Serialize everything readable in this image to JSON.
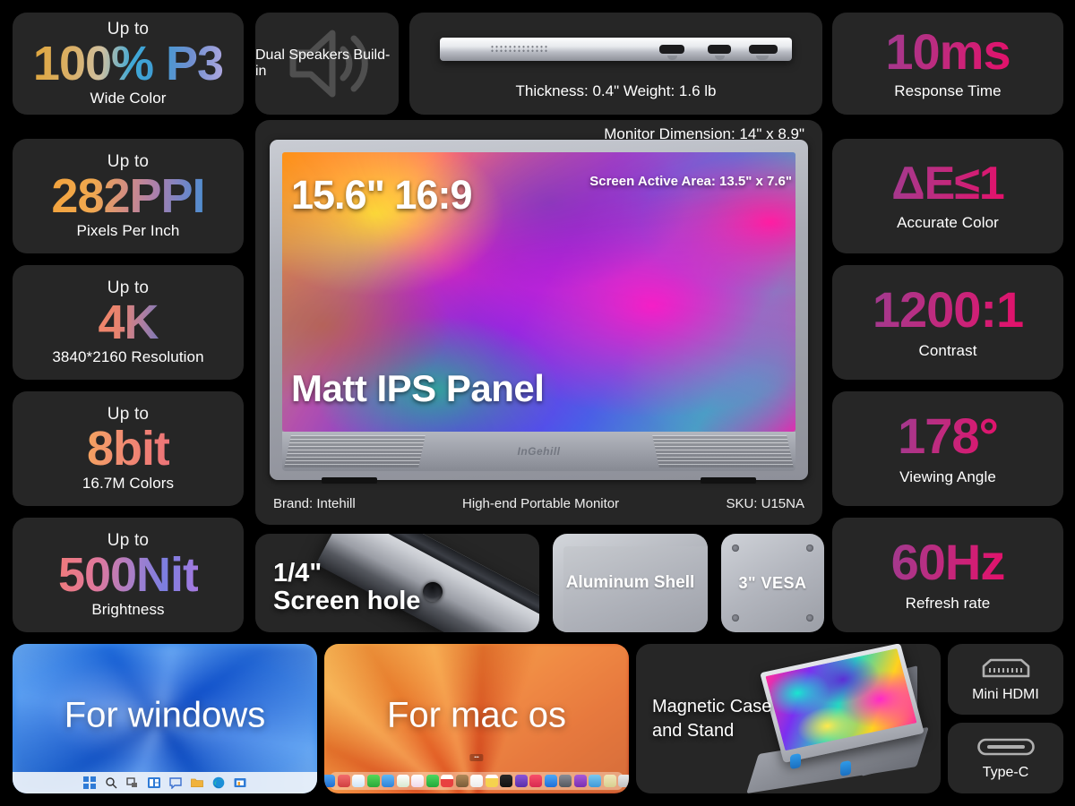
{
  "meta": {
    "background": "#000000",
    "card_bg": "#262626"
  },
  "left_specs": [
    {
      "eyebrow": "Up to",
      "value": "100% P3",
      "caption": "Wide Color",
      "grad": "g-p3"
    },
    {
      "eyebrow": "Up to",
      "value": "282PPI",
      "caption": "Pixels Per Inch",
      "grad": "g-ppi"
    },
    {
      "eyebrow": "Up to",
      "value": "4K",
      "caption": "3840*2160 Resolution",
      "grad": "g-4k"
    },
    {
      "eyebrow": "Up to",
      "value": "8bit",
      "caption": "16.7M Colors",
      "grad": "g-8bit"
    },
    {
      "eyebrow": "Up to",
      "value": "500Nit",
      "caption": "Brightness",
      "grad": "g-nit"
    }
  ],
  "right_specs": [
    {
      "value": "10ms",
      "caption": "Response Time"
    },
    {
      "value": "ΔE≤1",
      "caption": "Accurate Color"
    },
    {
      "value": "1200:1",
      "caption": "Contrast"
    },
    {
      "value": "178°",
      "caption": "Viewing Angle"
    },
    {
      "value": "60Hz",
      "caption": "Refresh rate"
    }
  ],
  "speakers": {
    "label": "Dual Speakers Build-in",
    "icon": "speaker-icon"
  },
  "thickness": {
    "caption": "Thickness: 0.4\"  Weight: 1.6 lb"
  },
  "monitor": {
    "dimension": "Monitor Dimension: 14\" x 8.9\"",
    "active_area": "Screen Active Area:  13.5\" x 7.6\"",
    "size_ratio": "15.6\" 16:9",
    "panel": "Matt IPS Panel",
    "logo": "InGehill",
    "brand": "Brand: Intehill",
    "tagline": "High-end Portable Monitor",
    "sku": "SKU: U15NA"
  },
  "screw_hole": {
    "line1": "1/4\"",
    "line2": "Screen hole"
  },
  "aluminum": {
    "label": "Aluminum Shell"
  },
  "vesa": {
    "label": "3\" VESA"
  },
  "os_support": [
    {
      "label": "For windows"
    },
    {
      "label": "For mac os"
    }
  ],
  "stand": {
    "line1": "Magnetic Case",
    "line2": "and Stand"
  },
  "ports": [
    {
      "label": "Mini HDMI",
      "icon": "hdmi-port-icon"
    },
    {
      "label": "Type-C",
      "icon": "typec-port-icon"
    }
  ],
  "colors": {
    "accent_pink": "#e4106a",
    "accent_purple": "#a13a8f",
    "windows_blue": "#1565e0",
    "macos_orange": "#e8662a"
  }
}
